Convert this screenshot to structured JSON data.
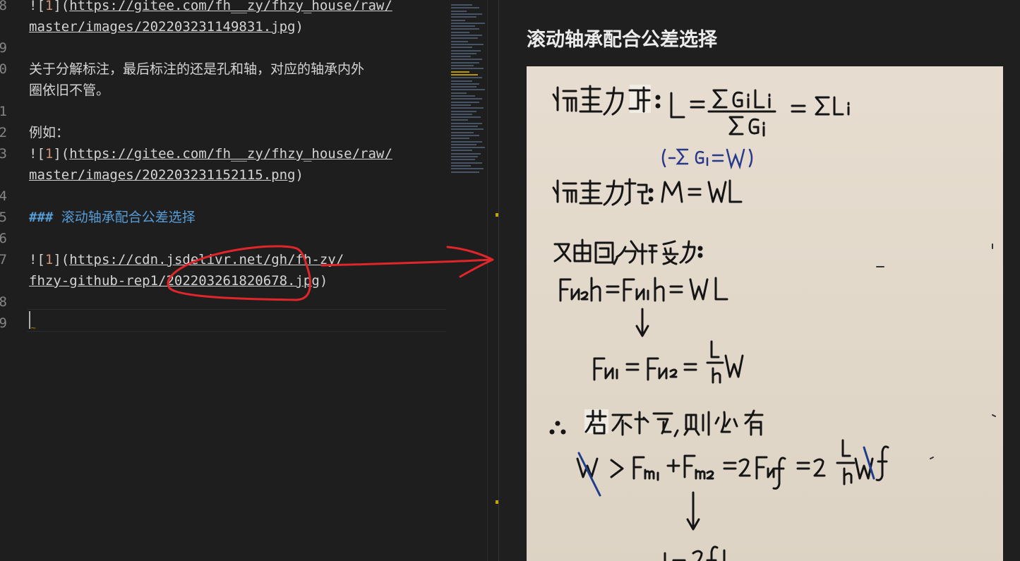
{
  "editor": {
    "lines": [
      {
        "num": "8",
        "parts": [
          {
            "cls": "bang",
            "text": "!["
          },
          {
            "cls": "alt",
            "text": "1"
          },
          {
            "cls": "bang",
            "text": "]("
          },
          {
            "cls": "url",
            "text": "https://gitee.com/fh__zy/fhzy_house/raw/"
          }
        ]
      },
      {
        "num": "",
        "parts": [
          {
            "cls": "url",
            "text": "master/images/202203231149831.jpg"
          },
          {
            "cls": "bang",
            "text": ")"
          }
        ]
      },
      {
        "num": "9",
        "parts": []
      },
      {
        "num": "0",
        "parts": [
          {
            "cls": "cjk",
            "text": "关于分解标注，最后标注的还是孔和轴，对应的轴承内外"
          }
        ]
      },
      {
        "num": "",
        "parts": [
          {
            "cls": "cjk",
            "text": "圈依旧不管。"
          }
        ]
      },
      {
        "num": "1",
        "parts": []
      },
      {
        "num": "2",
        "parts": [
          {
            "cls": "cjk",
            "text": "例如："
          }
        ]
      },
      {
        "num": "3",
        "parts": [
          {
            "cls": "bang",
            "text": "!["
          },
          {
            "cls": "alt",
            "text": "1"
          },
          {
            "cls": "bang",
            "text": "]("
          },
          {
            "cls": "url",
            "text": "https://gitee.com/fh__zy/fhzy_house/raw/"
          }
        ]
      },
      {
        "num": "",
        "parts": [
          {
            "cls": "url",
            "text": "master/images/202203231152115.png"
          },
          {
            "cls": "bang",
            "text": ")"
          }
        ]
      },
      {
        "num": "4",
        "parts": []
      },
      {
        "num": "5",
        "parts": [
          {
            "cls": "heading",
            "text": "### "
          },
          {
            "cls": "heading-text",
            "text": "滚动轴承配合公差选择"
          }
        ]
      },
      {
        "num": "6",
        "parts": []
      },
      {
        "num": "7",
        "parts": [
          {
            "cls": "bang",
            "text": "!["
          },
          {
            "cls": "alt",
            "text": "1"
          },
          {
            "cls": "bang",
            "text": "]("
          },
          {
            "cls": "url",
            "text": "https://cdn.jsdelivr.net/gh/fh-zy/"
          }
        ]
      },
      {
        "num": "",
        "parts": [
          {
            "cls": "url",
            "text": "fhzy-github-rep1/202203261820678.jpg"
          },
          {
            "cls": "bang",
            "text": ")"
          }
        ]
      },
      {
        "num": "8",
        "parts": []
      },
      {
        "num": "9",
        "parts": []
      }
    ]
  },
  "preview": {
    "title": "滚动轴承配合公差选择",
    "image_alt": "1"
  },
  "colors": {
    "annotation_red": "#e0262a",
    "heading_blue": "#569cd6",
    "alt_orange": "#ce9178"
  }
}
